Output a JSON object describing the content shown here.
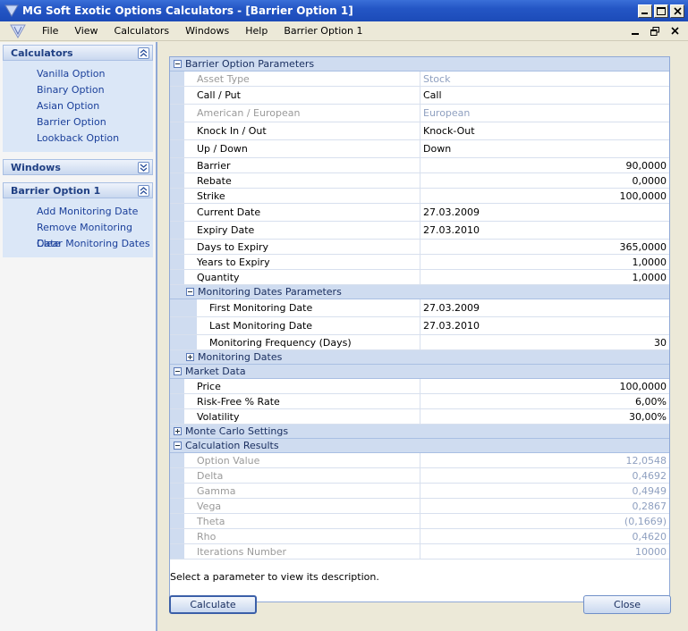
{
  "window": {
    "title": "MG Soft Exotic Options Calculators - [Barrier Option 1]"
  },
  "menu": [
    "File",
    "View",
    "Calculators",
    "Windows",
    "Help",
    "Barrier Option 1"
  ],
  "sidebar": {
    "calculators": {
      "title": "Calculators",
      "items": [
        "Vanilla Option",
        "Binary Option",
        "Asian Option",
        "Barrier Option",
        "Lookback Option"
      ]
    },
    "windows": {
      "title": "Windows"
    },
    "barrier": {
      "title": "Barrier Option 1",
      "items": [
        "Add Monitoring Date",
        "Remove Monitoring Date",
        "Clear Monitoring Dates"
      ]
    }
  },
  "grid": {
    "params_title": "Barrier Option Parameters",
    "params": [
      {
        "name": "Asset Type",
        "value": "Stock"
      },
      {
        "name": "Call / Put",
        "value": "Call"
      },
      {
        "name": "American / European",
        "value": "European"
      },
      {
        "name": "Knock In / Out",
        "value": "Knock-Out"
      },
      {
        "name": "Up / Down",
        "value": "Down"
      },
      {
        "name": "Barrier",
        "value": "90,0000"
      },
      {
        "name": "Rebate",
        "value": "0,0000"
      },
      {
        "name": "Strike",
        "value": "100,0000"
      },
      {
        "name": "Current Date",
        "value": "27.03.2009"
      },
      {
        "name": "Expiry Date",
        "value": "27.03.2010"
      },
      {
        "name": "Days to Expiry",
        "value": "365,0000"
      },
      {
        "name": "Years to Expiry",
        "value": "1,0000"
      },
      {
        "name": "Quantity",
        "value": "1,0000"
      }
    ],
    "monitoring_title": "Monitoring Dates Parameters",
    "monitoring": [
      {
        "name": "First Monitoring Date",
        "value": "27.03.2009"
      },
      {
        "name": "Last Monitoring Date",
        "value": "27.03.2010"
      },
      {
        "name": "Monitoring Frequency (Days)",
        "value": "30"
      }
    ],
    "monitoring_dates_title": "Monitoring Dates",
    "market_title": "Market Data",
    "market": [
      {
        "name": "Price",
        "value": "100,0000"
      },
      {
        "name": "Risk-Free % Rate",
        "value": "6,00%"
      },
      {
        "name": "Volatility",
        "value": "30,00%"
      }
    ],
    "monte_title": "Monte Carlo Settings",
    "results_title": "Calculation Results",
    "results": [
      {
        "name": "Option Value",
        "value": "12,0548"
      },
      {
        "name": "Delta",
        "value": "0,4692"
      },
      {
        "name": "Gamma",
        "value": "0,4949"
      },
      {
        "name": "Vega",
        "value": "0,2867"
      },
      {
        "name": "Theta",
        "value": "(0,1669)"
      },
      {
        "name": "Rho",
        "value": "0,4620"
      },
      {
        "name": "Iterations Number",
        "value": "10000"
      }
    ]
  },
  "description": "Select a parameter to view its description.",
  "buttons": {
    "calculate": "Calculate",
    "close": "Close"
  }
}
